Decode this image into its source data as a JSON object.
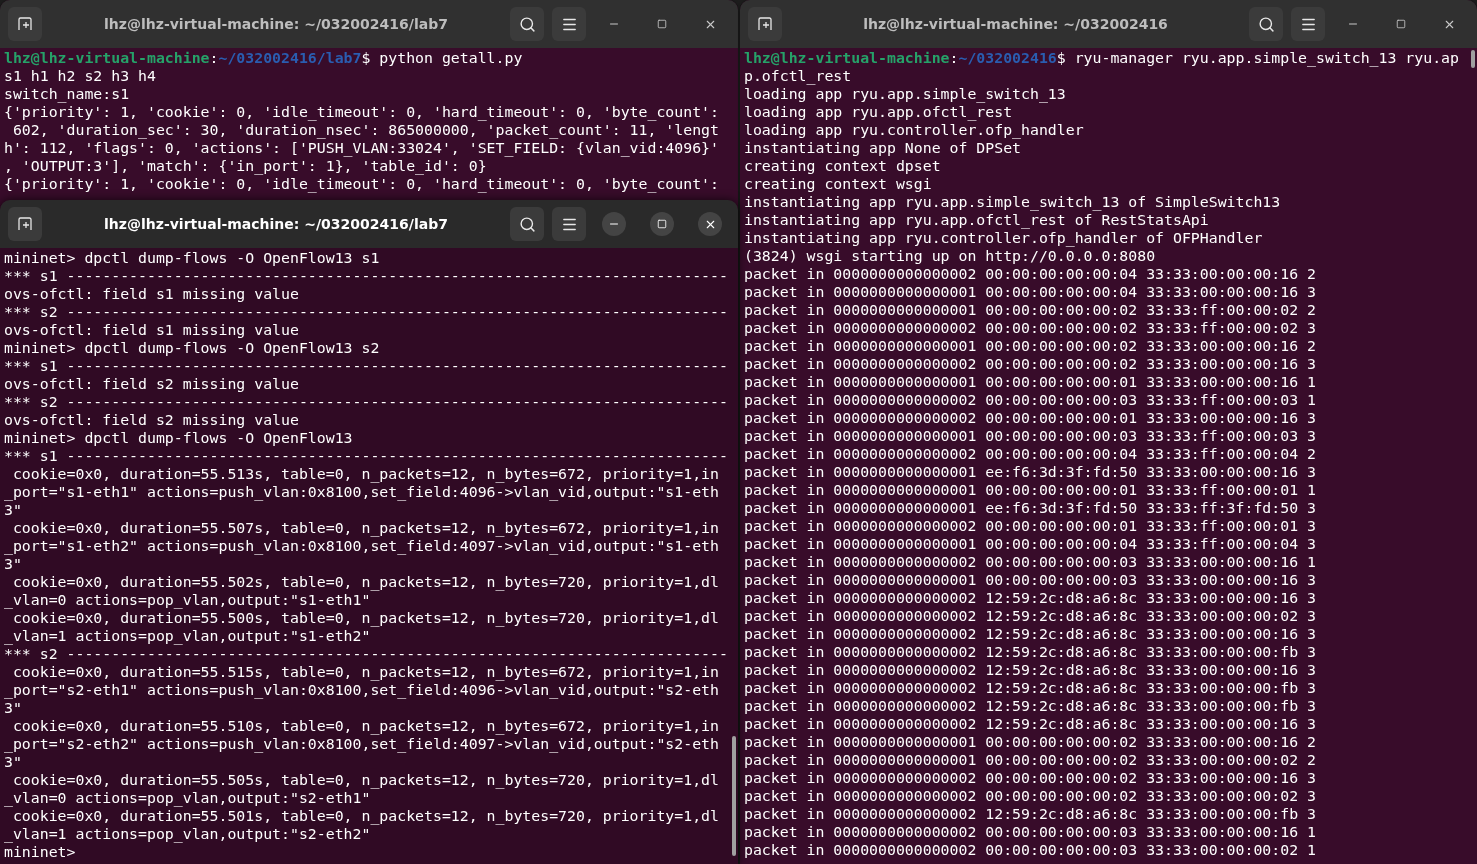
{
  "windows": [
    {
      "title": "lhz@lhz-virtual-machine: ~/032002416/lab7",
      "active": false,
      "lines": [
        {
          "kind": "prompt",
          "user": "lhz@lhz-virtual-machine",
          "sep": ":",
          "path": "~/032002416/lab7",
          "rest": "$ python getall.py"
        },
        {
          "kind": "text",
          "text": "s1 h1 h2 s2 h3 h4"
        },
        {
          "kind": "text",
          "text": "switch_name:s1"
        },
        {
          "kind": "text",
          "text": "{'priority': 1, 'cookie': 0, 'idle_timeout': 0, 'hard_timeout': 0, 'byte_count':"
        },
        {
          "kind": "text",
          "text": " 602, 'duration_sec': 30, 'duration_nsec': 865000000, 'packet_count': 11, 'lengt"
        },
        {
          "kind": "text",
          "text": "h': 112, 'flags': 0, 'actions': ['PUSH_VLAN:33024', 'SET_FIELD: {vlan_vid:4096}'"
        },
        {
          "kind": "text",
          "text": ", 'OUTPUT:3'], 'match': {'in_port': 1}, 'table_id': 0}"
        },
        {
          "kind": "text",
          "text": "{'priority': 1, 'cookie': 0, 'idle_timeout': 0, 'hard_timeout': 0, 'byte_count':"
        }
      ]
    },
    {
      "title": "lhz@lhz-virtual-machine: ~/032002416/lab7",
      "active": true,
      "lines": [
        {
          "kind": "text",
          "text": "mininet> dpctl dump-flows -O OpenFlow13 s1"
        },
        {
          "kind": "text",
          "text": "*** s1 --------------------------------------------------------------------------"
        },
        {
          "kind": "text",
          "text": "ovs-ofctl: field s1 missing value"
        },
        {
          "kind": "text",
          "text": "*** s2 --------------------------------------------------------------------------"
        },
        {
          "kind": "text",
          "text": "ovs-ofctl: field s1 missing value"
        },
        {
          "kind": "text",
          "text": "mininet> dpctl dump-flows -O OpenFlow13 s2"
        },
        {
          "kind": "text",
          "text": "*** s1 --------------------------------------------------------------------------"
        },
        {
          "kind": "text",
          "text": "ovs-ofctl: field s2 missing value"
        },
        {
          "kind": "text",
          "text": "*** s2 --------------------------------------------------------------------------"
        },
        {
          "kind": "text",
          "text": "ovs-ofctl: field s2 missing value"
        },
        {
          "kind": "text",
          "text": "mininet> dpctl dump-flows -O OpenFlow13"
        },
        {
          "kind": "text",
          "text": "*** s1 --------------------------------------------------------------------------"
        },
        {
          "kind": "text",
          "text": " cookie=0x0, duration=55.513s, table=0, n_packets=12, n_bytes=672, priority=1,in"
        },
        {
          "kind": "text",
          "text": "_port=\"s1-eth1\" actions=push_vlan:0x8100,set_field:4096->vlan_vid,output:\"s1-eth"
        },
        {
          "kind": "text",
          "text": "3\""
        },
        {
          "kind": "text",
          "text": " cookie=0x0, duration=55.507s, table=0, n_packets=12, n_bytes=672, priority=1,in"
        },
        {
          "kind": "text",
          "text": "_port=\"s1-eth2\" actions=push_vlan:0x8100,set_field:4097->vlan_vid,output:\"s1-eth"
        },
        {
          "kind": "text",
          "text": "3\""
        },
        {
          "kind": "text",
          "text": " cookie=0x0, duration=55.502s, table=0, n_packets=12, n_bytes=720, priority=1,dl"
        },
        {
          "kind": "text",
          "text": "_vlan=0 actions=pop_vlan,output:\"s1-eth1\""
        },
        {
          "kind": "text",
          "text": " cookie=0x0, duration=55.500s, table=0, n_packets=12, n_bytes=720, priority=1,dl"
        },
        {
          "kind": "text",
          "text": "_vlan=1 actions=pop_vlan,output:\"s1-eth2\""
        },
        {
          "kind": "text",
          "text": "*** s2 --------------------------------------------------------------------------"
        },
        {
          "kind": "text",
          "text": " cookie=0x0, duration=55.515s, table=0, n_packets=12, n_bytes=672, priority=1,in"
        },
        {
          "kind": "text",
          "text": "_port=\"s2-eth1\" actions=push_vlan:0x8100,set_field:4096->vlan_vid,output:\"s2-eth"
        },
        {
          "kind": "text",
          "text": "3\""
        },
        {
          "kind": "text",
          "text": " cookie=0x0, duration=55.510s, table=0, n_packets=12, n_bytes=672, priority=1,in"
        },
        {
          "kind": "text",
          "text": "_port=\"s2-eth2\" actions=push_vlan:0x8100,set_field:4097->vlan_vid,output:\"s2-eth"
        },
        {
          "kind": "text",
          "text": "3\""
        },
        {
          "kind": "text",
          "text": " cookie=0x0, duration=55.505s, table=0, n_packets=12, n_bytes=720, priority=1,dl"
        },
        {
          "kind": "text",
          "text": "_vlan=0 actions=pop_vlan,output:\"s2-eth1\""
        },
        {
          "kind": "text",
          "text": " cookie=0x0, duration=55.501s, table=0, n_packets=12, n_bytes=720, priority=1,dl"
        },
        {
          "kind": "text",
          "text": "_vlan=1 actions=pop_vlan,output:\"s2-eth2\""
        },
        {
          "kind": "text",
          "text": "mininet>"
        }
      ]
    },
    {
      "title": "lhz@lhz-virtual-machine: ~/032002416",
      "active": false,
      "lines": [
        {
          "kind": "prompt",
          "user": "lhz@lhz-virtual-machine",
          "sep": ":",
          "path": "~/032002416",
          "rest": "$ ryu-manager ryu.app.simple_switch_13 ryu.ap"
        },
        {
          "kind": "text",
          "text": "p.ofctl_rest"
        },
        {
          "kind": "text",
          "text": "loading app ryu.app.simple_switch_13"
        },
        {
          "kind": "text",
          "text": "loading app ryu.app.ofctl_rest"
        },
        {
          "kind": "text",
          "text": "loading app ryu.controller.ofp_handler"
        },
        {
          "kind": "text",
          "text": "instantiating app None of DPSet"
        },
        {
          "kind": "text",
          "text": "creating context dpset"
        },
        {
          "kind": "text",
          "text": "creating context wsgi"
        },
        {
          "kind": "text",
          "text": "instantiating app ryu.app.simple_switch_13 of SimpleSwitch13"
        },
        {
          "kind": "text",
          "text": "instantiating app ryu.app.ofctl_rest of RestStatsApi"
        },
        {
          "kind": "text",
          "text": "instantiating app ryu.controller.ofp_handler of OFPHandler"
        },
        {
          "kind": "text",
          "text": "(3824) wsgi starting up on http://0.0.0.0:8080"
        },
        {
          "kind": "text",
          "text": "packet in 0000000000000002 00:00:00:00:00:04 33:33:00:00:00:16 2"
        },
        {
          "kind": "text",
          "text": "packet in 0000000000000001 00:00:00:00:00:04 33:33:00:00:00:16 3"
        },
        {
          "kind": "text",
          "text": "packet in 0000000000000001 00:00:00:00:00:02 33:33:ff:00:00:02 2"
        },
        {
          "kind": "text",
          "text": "packet in 0000000000000002 00:00:00:00:00:02 33:33:ff:00:00:02 3"
        },
        {
          "kind": "text",
          "text": "packet in 0000000000000001 00:00:00:00:00:02 33:33:00:00:00:16 2"
        },
        {
          "kind": "text",
          "text": "packet in 0000000000000002 00:00:00:00:00:02 33:33:00:00:00:16 3"
        },
        {
          "kind": "text",
          "text": "packet in 0000000000000001 00:00:00:00:00:01 33:33:00:00:00:16 1"
        },
        {
          "kind": "text",
          "text": "packet in 0000000000000002 00:00:00:00:00:03 33:33:ff:00:00:03 1"
        },
        {
          "kind": "text",
          "text": "packet in 0000000000000002 00:00:00:00:00:01 33:33:00:00:00:16 3"
        },
        {
          "kind": "text",
          "text": "packet in 0000000000000001 00:00:00:00:00:03 33:33:ff:00:00:03 3"
        },
        {
          "kind": "text",
          "text": "packet in 0000000000000002 00:00:00:00:00:04 33:33:ff:00:00:04 2"
        },
        {
          "kind": "text",
          "text": "packet in 0000000000000001 ee:f6:3d:3f:fd:50 33:33:00:00:00:16 3"
        },
        {
          "kind": "text",
          "text": "packet in 0000000000000001 00:00:00:00:00:01 33:33:ff:00:00:01 1"
        },
        {
          "kind": "text",
          "text": "packet in 0000000000000001 ee:f6:3d:3f:fd:50 33:33:ff:3f:fd:50 3"
        },
        {
          "kind": "text",
          "text": "packet in 0000000000000002 00:00:00:00:00:01 33:33:ff:00:00:01 3"
        },
        {
          "kind": "text",
          "text": "packet in 0000000000000001 00:00:00:00:00:04 33:33:ff:00:00:04 3"
        },
        {
          "kind": "text",
          "text": "packet in 0000000000000002 00:00:00:00:00:03 33:33:00:00:00:16 1"
        },
        {
          "kind": "text",
          "text": "packet in 0000000000000001 00:00:00:00:00:03 33:33:00:00:00:16 3"
        },
        {
          "kind": "text",
          "text": "packet in 0000000000000002 12:59:2c:d8:a6:8c 33:33:00:00:00:16 3"
        },
        {
          "kind": "text",
          "text": "packet in 0000000000000002 12:59:2c:d8:a6:8c 33:33:00:00:00:02 3"
        },
        {
          "kind": "text",
          "text": "packet in 0000000000000002 12:59:2c:d8:a6:8c 33:33:00:00:00:16 3"
        },
        {
          "kind": "text",
          "text": "packet in 0000000000000002 12:59:2c:d8:a6:8c 33:33:00:00:00:fb 3"
        },
        {
          "kind": "text",
          "text": "packet in 0000000000000002 12:59:2c:d8:a6:8c 33:33:00:00:00:16 3"
        },
        {
          "kind": "text",
          "text": "packet in 0000000000000002 12:59:2c:d8:a6:8c 33:33:00:00:00:fb 3"
        },
        {
          "kind": "text",
          "text": "packet in 0000000000000002 12:59:2c:d8:a6:8c 33:33:00:00:00:fb 3"
        },
        {
          "kind": "text",
          "text": "packet in 0000000000000002 12:59:2c:d8:a6:8c 33:33:00:00:00:16 3"
        },
        {
          "kind": "text",
          "text": "packet in 0000000000000001 00:00:00:00:00:02 33:33:00:00:00:16 2"
        },
        {
          "kind": "text",
          "text": "packet in 0000000000000001 00:00:00:00:00:02 33:33:00:00:00:02 2"
        },
        {
          "kind": "text",
          "text": "packet in 0000000000000002 00:00:00:00:00:02 33:33:00:00:00:16 3"
        },
        {
          "kind": "text",
          "text": "packet in 0000000000000002 00:00:00:00:00:02 33:33:00:00:00:02 3"
        },
        {
          "kind": "text",
          "text": "packet in 0000000000000002 12:59:2c:d8:a6:8c 33:33:00:00:00:fb 3"
        },
        {
          "kind": "text",
          "text": "packet in 0000000000000002 00:00:00:00:00:03 33:33:00:00:00:16 1"
        },
        {
          "kind": "text",
          "text": "packet in 0000000000000002 00:00:00:00:00:03 33:33:00:00:00:02 1"
        }
      ]
    }
  ]
}
